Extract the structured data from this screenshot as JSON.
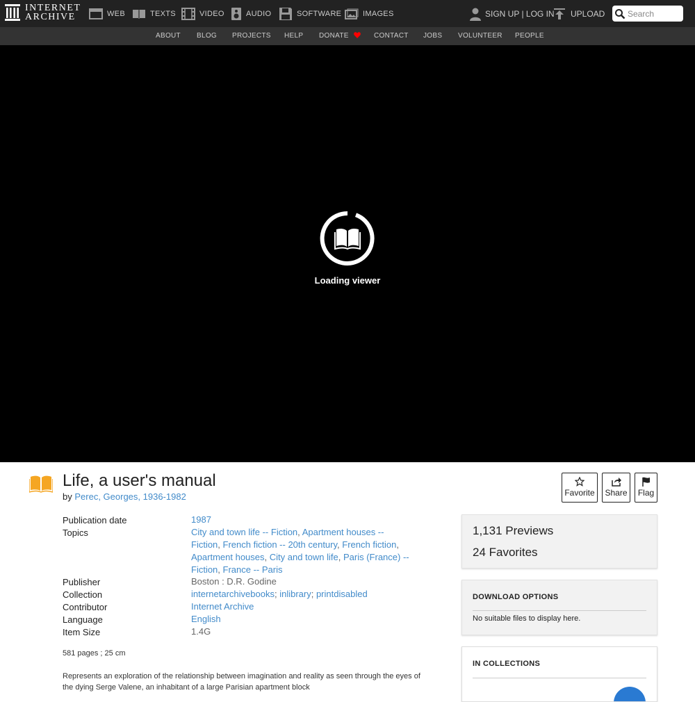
{
  "topnav": {
    "logo_line1": "INTERNET",
    "logo_line2": "ARCHIVE",
    "media": [
      {
        "label": "WEB",
        "icon": "web-icon"
      },
      {
        "label": "TEXTS",
        "icon": "texts-icon"
      },
      {
        "label": "VIDEO",
        "icon": "video-icon"
      },
      {
        "label": "AUDIO",
        "icon": "audio-icon"
      },
      {
        "label": "SOFTWARE",
        "icon": "software-icon"
      },
      {
        "label": "IMAGES",
        "icon": "images-icon"
      }
    ],
    "signup_label": "SIGN UP | LOG IN",
    "upload_label": "UPLOAD",
    "search_placeholder": "Search"
  },
  "subnav": {
    "items": [
      "ABOUT",
      "BLOG",
      "PROJECTS",
      "HELP",
      "DONATE",
      "CONTACT",
      "JOBS",
      "VOLUNTEER",
      "PEOPLE"
    ]
  },
  "viewer": {
    "loading_text": "Loading viewer"
  },
  "item": {
    "title": "Life, a user's manual",
    "by_prefix": "by",
    "author": "Perec, Georges, 1936-1982",
    "actions": {
      "favorite": "Favorite",
      "share": "Share",
      "flag": "Flag"
    },
    "metadata": {
      "publication_date_label": "Publication date",
      "publication_date": "1987",
      "topics_label": "Topics",
      "topics": [
        "City and town life -- Fiction",
        "Apartment houses -- Fiction",
        "French fiction -- 20th century",
        "French fiction",
        "Apartment houses",
        "City and town life",
        "Paris (France) -- Fiction",
        "France -- Paris"
      ],
      "publisher_label": "Publisher",
      "publisher": "Boston : D.R. Godine",
      "collection_label": "Collection",
      "collections": [
        "internetarchivebooks",
        "inlibrary",
        "printdisabled"
      ],
      "contributor_label": "Contributor",
      "contributor": "Internet Archive",
      "language_label": "Language",
      "language": "English",
      "item_size_label": "Item Size",
      "item_size": "1.4G"
    },
    "physical_description": "581 pages ; 25 cm",
    "description": "Represents an exploration of the relationship between imagination and reality as seen through the eyes of the dying Serge Valene, an inhabitant of a large Parisian apartment block"
  },
  "sidebar": {
    "previews": "1,131 Previews",
    "favorites": "24 Favorites",
    "download_heading": "DOWNLOAD OPTIONS",
    "no_files": "No suitable files to display here.",
    "collections_heading": "IN COLLECTIONS"
  },
  "colors": {
    "link": "#428bca",
    "topbar": "#222222",
    "subbar": "#333333",
    "donate_heart": "#ff0000",
    "book_icon": "#f5a623"
  }
}
